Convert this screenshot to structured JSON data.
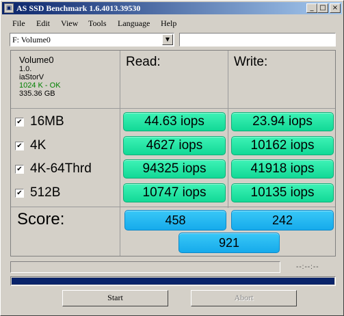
{
  "window": {
    "title": "AS SSD Benchmark 1.6.4013.39530",
    "icon": "ssd-app-icon",
    "controls": {
      "minimize": "_",
      "maximize": "□",
      "close": "×"
    }
  },
  "menu": [
    "File",
    "Edit",
    "View",
    "Tools",
    "Language",
    "Help"
  ],
  "drive": {
    "selected": "F: Volume0",
    "extra_field_value": ""
  },
  "info": {
    "name": "Volume0",
    "version": "1.0.",
    "driver": "iaStorV",
    "alignment": "1024 K - OK",
    "size": "335.36 GB",
    "ok_color": "#008000"
  },
  "headers": {
    "read": "Read:",
    "write": "Write:"
  },
  "tests": [
    {
      "label": "16MB",
      "checked": "✔",
      "read": "44.63 iops",
      "write": "23.94 iops"
    },
    {
      "label": "4K",
      "checked": "✔",
      "read": "4627 iops",
      "write": "10162 iops"
    },
    {
      "label": "4K-64Thrd",
      "checked": "✔",
      "read": "94325 iops",
      "write": "41918 iops"
    },
    {
      "label": "512B",
      "checked": "✔",
      "read": "10747 iops",
      "write": "10135 iops"
    }
  ],
  "score": {
    "label": "Score:",
    "read": "458",
    "write": "242",
    "total": "921"
  },
  "colors": {
    "result_green": "#1fe5a4",
    "score_blue": "#22b6ef",
    "progress_fill": "#0a246a"
  },
  "progress": {
    "time": "--:--:--",
    "main_fill_fraction": 1.0
  },
  "buttons": {
    "start": "Start",
    "abort": "Abort"
  }
}
